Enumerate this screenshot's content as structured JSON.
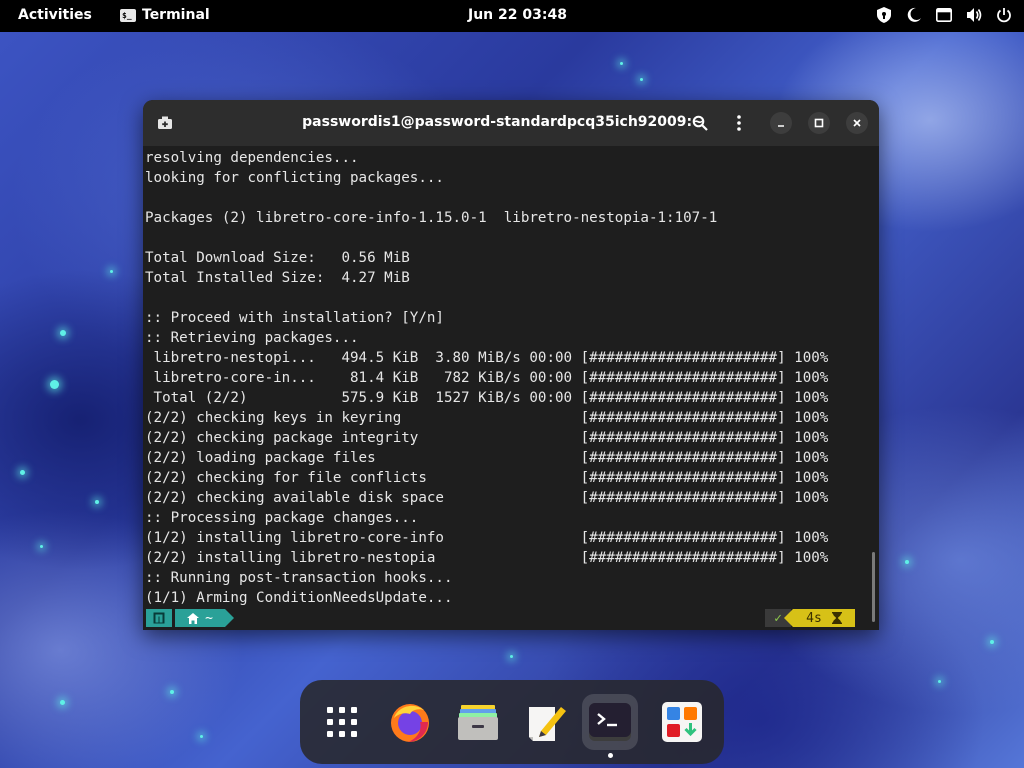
{
  "topbar": {
    "activities": "Activities",
    "app_name": "Terminal",
    "app_icon_glyph": "$_",
    "clock": "Jun 22  03:48",
    "tray_icons": [
      "privacy-shield-icon",
      "night-light-icon",
      "display-icon",
      "volume-icon",
      "power-icon"
    ]
  },
  "window": {
    "title": "passwordis1@password-standardpcq35ich92009:~",
    "lines": [
      "resolving dependencies...",
      "looking for conflicting packages...",
      "",
      "Packages (2) libretro-core-info-1.15.0-1  libretro-nestopia-1:107-1",
      "",
      "Total Download Size:   0.56 MiB",
      "Total Installed Size:  4.27 MiB",
      "",
      ":: Proceed with installation? [Y/n]",
      ":: Retrieving packages...",
      " libretro-nestopi...   494.5 KiB  3.80 MiB/s 00:00 [######################] 100%",
      " libretro-core-in...    81.4 KiB   782 KiB/s 00:00 [######################] 100%",
      " Total (2/2)           575.9 KiB  1527 KiB/s 00:00 [######################] 100%",
      "(2/2) checking keys in keyring                     [######################] 100%",
      "(2/2) checking package integrity                   [######################] 100%",
      "(2/2) loading package files                        [######################] 100%",
      "(2/2) checking for file conflicts                  [######################] 100%",
      "(2/2) checking available disk space                [######################] 100%",
      ":: Processing package changes...",
      "(1/2) installing libretro-core-info                [######################] 100%",
      "(2/2) installing libretro-nestopia                 [######################] 100%",
      ":: Running post-transaction hooks...",
      "(1/1) Arming ConditionNeedsUpdate..."
    ],
    "prompt": {
      "dir": "~",
      "status": "✓",
      "duration": "4s"
    }
  },
  "dock": {
    "items": [
      {
        "name": "app-grid-icon"
      },
      {
        "name": "firefox-icon"
      },
      {
        "name": "files-icon"
      },
      {
        "name": "text-editor-icon"
      },
      {
        "name": "terminal-icon"
      },
      {
        "name": "software-icon"
      }
    ]
  },
  "colors": {
    "prompt_segment": "#2aa198",
    "duration_segment": "#d7c117",
    "terminal_bg": "#1e1e1e",
    "titlebar_bg": "#2d2d2d"
  }
}
